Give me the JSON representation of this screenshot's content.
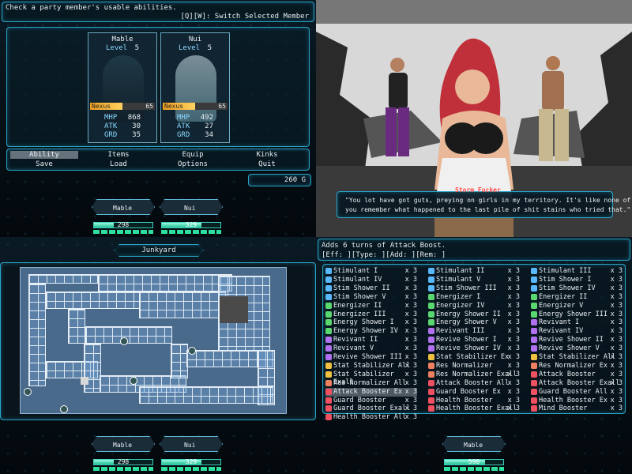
{
  "colors": {
    "accent": "#2aa4c8",
    "stat_label": "#8ad8ff",
    "nexus_bar": "#f0a020",
    "hp_bar": "#20c090"
  },
  "q1": {
    "help_text": "Check a party member's usable abilities.",
    "switch_hint": "[Q][W]: Switch Selected Member",
    "members": [
      {
        "name": "Mable",
        "level_label": "Level",
        "level": "5",
        "nexus_label": "Nexus",
        "nexus": "65",
        "nexus_fill": 0.5,
        "stats": [
          {
            "label": "MHP",
            "value": "868"
          },
          {
            "label": "ATK",
            "value": "30"
          },
          {
            "label": "GRD",
            "value": "35"
          }
        ]
      },
      {
        "name": "Nui",
        "level_label": "Level",
        "level": "5",
        "nexus_label": "Nexus",
        "nexus": "65",
        "nexus_fill": 0.5,
        "stats": [
          {
            "label": "MHP",
            "value": "492"
          },
          {
            "label": "ATK",
            "value": "27"
          },
          {
            "label": "GRD",
            "value": "34"
          }
        ]
      }
    ],
    "menu": [
      "Ability",
      "Items",
      "Equip",
      "Kinks",
      "Save",
      "Load",
      "Options",
      "Quit"
    ],
    "gold": "260 G",
    "strip": [
      {
        "name": "Mable",
        "hp": "298",
        "hp_fill": 0.34
      },
      {
        "name": "Nui",
        "hp": "329",
        "hp_fill": 0.67
      }
    ]
  },
  "q2": {
    "speaker": "Storm Fucker",
    "dialogue_line1": "\"You lot have got guts, preying on girls in my territory. It's like none of",
    "dialogue_line2": "you remember what happened to the last pile of shit stains who tried that.\""
  },
  "q3": {
    "location": "Junkyard",
    "strip": [
      {
        "name": "Mable",
        "hp": "298",
        "hp_fill": 0.34
      },
      {
        "name": "Nui",
        "hp": "329",
        "hp_fill": 0.67
      }
    ]
  },
  "q4": {
    "description": "Adds 6 turns of Attack Boost.",
    "eff_line": "[Eff:         ][Type: ][Add:        ][Rem: ]",
    "items": [
      [
        {
          "name": "Stimulant I",
          "qty": "x 3",
          "color": "#5ab8ff"
        },
        {
          "name": "Stimulant IV",
          "qty": "x 3",
          "color": "#5ab8ff"
        },
        {
          "name": "Stim Shower II",
          "qty": "x 3",
          "color": "#5ab8ff"
        },
        {
          "name": "Stim Shower V",
          "qty": "x 3",
          "color": "#5ab8ff"
        },
        {
          "name": "Energizer II",
          "qty": "x 3",
          "color": "#5ad870"
        },
        {
          "name": "Energizer III",
          "qty": "x 3",
          "color": "#5ad870"
        },
        {
          "name": "Energy Shower I",
          "qty": "x 3",
          "color": "#5ad870"
        },
        {
          "name": "Energy Shower IV",
          "qty": "x 3",
          "color": "#5ad870"
        },
        {
          "name": "Revivant II",
          "qty": "x 3",
          "color": "#b070f0"
        },
        {
          "name": "Revivant V",
          "qty": "x 3",
          "color": "#b070f0"
        },
        {
          "name": "Revive Shower III",
          "qty": "x 3",
          "color": "#b070f0"
        },
        {
          "name": "Stat Stabilizer All",
          "qty": "x 3",
          "color": "#f0c040"
        },
        {
          "name": "Stat Stabilizer Exall",
          "qty": "x 3",
          "color": "#f0c040"
        },
        {
          "name": "Res Normalizer All",
          "qty": "x 3",
          "color": "#f08060"
        },
        {
          "name": "Attack Booster Ex",
          "qty": "x 3",
          "color": "#f05060"
        },
        {
          "name": "Guard Booster",
          "qty": "x 3",
          "color": "#f05060"
        },
        {
          "name": "Guard Booster Exall",
          "qty": "x 3",
          "color": "#f05060"
        },
        {
          "name": "Health Booster All",
          "qty": "x 3",
          "color": "#f05060"
        }
      ],
      [
        {
          "name": "Stimulant II",
          "qty": "x 3",
          "color": "#5ab8ff"
        },
        {
          "name": "Stimulant V",
          "qty": "x 3",
          "color": "#5ab8ff"
        },
        {
          "name": "Stim Shower III",
          "qty": "x 3",
          "color": "#5ab8ff"
        },
        {
          "name": "Energizer I",
          "qty": "x 3",
          "color": "#5ad870"
        },
        {
          "name": "Energizer IV",
          "qty": "x 3",
          "color": "#5ad870"
        },
        {
          "name": "Energy Shower II",
          "qty": "x 3",
          "color": "#5ad870"
        },
        {
          "name": "Energy Shower V",
          "qty": "x 3",
          "color": "#5ad870"
        },
        {
          "name": "Revivant III",
          "qty": "x 3",
          "color": "#b070f0"
        },
        {
          "name": "Revive Shower I",
          "qty": "x 3",
          "color": "#b070f0"
        },
        {
          "name": "Revive Shower IV",
          "qty": "x 3",
          "color": "#b070f0"
        },
        {
          "name": "Stat Stabilizer Ex",
          "qty": "x 3",
          "color": "#f0c040"
        },
        {
          "name": "Res Normalizer",
          "qty": "x 3",
          "color": "#f08060"
        },
        {
          "name": "Res Normalizer Exall",
          "qty": "x 3",
          "color": "#f08060"
        },
        {
          "name": "Attack Booster All",
          "qty": "x 3",
          "color": "#f05060"
        },
        {
          "name": "Guard Booster Ex",
          "qty": "x 3",
          "color": "#f05060"
        },
        {
          "name": "Health Booster",
          "qty": "x 3",
          "color": "#f05060"
        },
        {
          "name": "Health Booster Exall",
          "qty": "x 3",
          "color": "#f05060"
        }
      ],
      [
        {
          "name": "Stimulant III",
          "qty": "x 3",
          "color": "#5ab8ff"
        },
        {
          "name": "Stim Shower I",
          "qty": "x 3",
          "color": "#5ab8ff"
        },
        {
          "name": "Stim Shower IV",
          "qty": "x 3",
          "color": "#5ab8ff"
        },
        {
          "name": "Energizer II",
          "qty": "x 3",
          "color": "#5ad870"
        },
        {
          "name": "Energizer V",
          "qty": "x 3",
          "color": "#5ad870"
        },
        {
          "name": "Energy Shower III",
          "qty": "x 3",
          "color": "#5ad870"
        },
        {
          "name": "Revivant I",
          "qty": "x 3",
          "color": "#b070f0"
        },
        {
          "name": "Revivant IV",
          "qty": "x 3",
          "color": "#b070f0"
        },
        {
          "name": "Revive Shower II",
          "qty": "x 3",
          "color": "#b070f0"
        },
        {
          "name": "Revive Shower V",
          "qty": "x 3",
          "color": "#b070f0"
        },
        {
          "name": "Stat Stabilizer All",
          "qty": "x 3",
          "color": "#f0c040"
        },
        {
          "name": "Res Normalizer Ex",
          "qty": "x 3",
          "color": "#f08060"
        },
        {
          "name": "Attack Booster",
          "qty": "x 3",
          "color": "#f05060"
        },
        {
          "name": "Attack Booster Exall",
          "qty": "x 3",
          "color": "#f05060"
        },
        {
          "name": "Guard Booster All",
          "qty": "x 3",
          "color": "#f05060"
        },
        {
          "name": "Health Booster Ex",
          "qty": "x 3",
          "color": "#f05060"
        },
        {
          "name": "Mind Booster",
          "qty": "x 3",
          "color": "#f05060"
        }
      ]
    ],
    "strip": [
      {
        "name": "Mable",
        "hp": "598",
        "hp_fill": 0.69
      }
    ]
  }
}
